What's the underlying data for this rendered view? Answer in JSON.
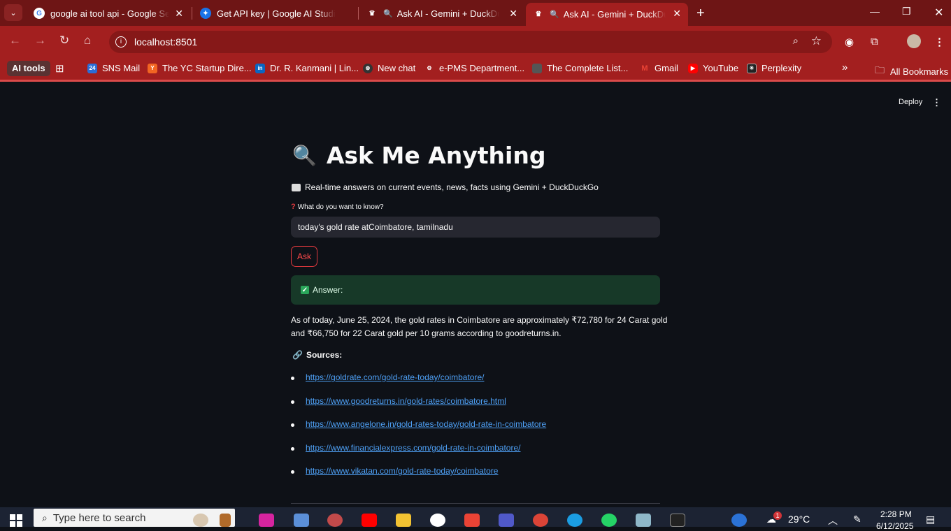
{
  "browser": {
    "tabs": [
      {
        "title": "google ai tool api - Google Sea",
        "icon": "google-icon"
      },
      {
        "title": "Get API key | Google AI Studio",
        "icon": "ai-studio-icon"
      },
      {
        "title": "Ask AI - Gemini + DuckDuckGo",
        "icon": "streamlit-icon"
      },
      {
        "title": "Ask AI - Gemini + DuckDuckGo",
        "icon": "streamlit-icon"
      }
    ],
    "url": "localhost:8501",
    "bookmarks": [
      {
        "label": "AI tools"
      },
      {
        "label": "SNS Mail",
        "badge": "24"
      },
      {
        "label": "The YC Startup Dire..."
      },
      {
        "label": "Dr. R. Kanmani | Lin..."
      },
      {
        "label": "New chat"
      },
      {
        "label": "e-PMS Department..."
      },
      {
        "label": "The Complete List..."
      },
      {
        "label": "Gmail"
      },
      {
        "label": "YouTube"
      },
      {
        "label": "Perplexity"
      },
      {
        "label": "All Bookmarks"
      }
    ],
    "colors": {
      "frame": "#6e1515",
      "toolbar": "#a31f1f"
    }
  },
  "app": {
    "deploy_label": "Deploy",
    "title": "Ask Me Anything",
    "subtitle": "Real-time answers on current events, news, facts using Gemini + DuckDuckGo",
    "question_label": "What do you want to know?",
    "question_value": "today's gold rate atCoimbatore, tamilnadu",
    "ask_label": "Ask",
    "answer_heading": "Answer:",
    "answer_text": "As of today, June 25, 2024, the gold rates in Coimbatore are approximately ₹72,780 for 24 Carat gold and ₹66,750 for 22 Carat gold per 10 grams according to goodreturns.in.",
    "sources_heading": "Sources:",
    "sources": [
      "https://goldrate.com/gold-rate-today/coimbatore/",
      "https://www.goodreturns.in/gold-rates/coimbatore.html",
      "https://www.angelone.in/gold-rates-today/gold-rate-in-coimbatore",
      "https://www.financialexpress.com/gold-rate-in-coimbatore/",
      "https://www.vikatan.com/gold-rate-today/coimbatore"
    ],
    "colors": {
      "background": "#0e1117",
      "accent": "#ff4b4b",
      "link": "#4ea0f5",
      "success_bg": "#173928"
    }
  },
  "taskbar": {
    "search_placeholder": "Type here to search",
    "weather": "29°C",
    "time": "2:28 PM",
    "date": "6/12/2025",
    "notification_badge": "1"
  }
}
